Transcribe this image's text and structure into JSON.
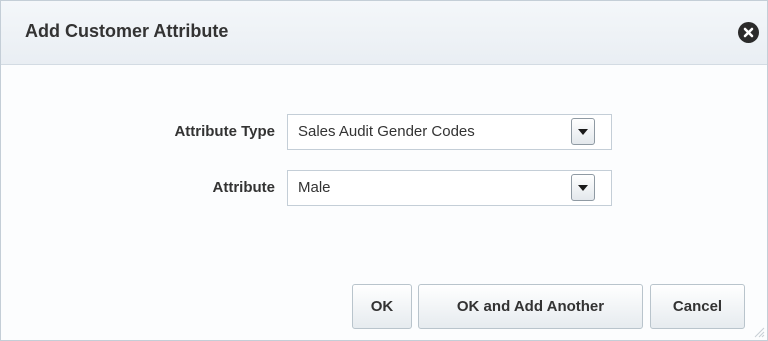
{
  "dialog": {
    "title": "Add Customer Attribute",
    "close_icon": "close-icon"
  },
  "form": {
    "attribute_type": {
      "label": "Attribute Type",
      "value": "Sales Audit Gender Codes",
      "dropdown_icon": "chevron-down-icon"
    },
    "attribute": {
      "label": "Attribute",
      "value": "Male",
      "dropdown_icon": "chevron-down-icon"
    }
  },
  "buttons": {
    "ok": "OK",
    "ok_add_another": "OK and Add Another",
    "cancel": "Cancel"
  },
  "colors": {
    "header_bg": "#eef2f6",
    "border": "#c4ced7",
    "text": "#333333"
  }
}
